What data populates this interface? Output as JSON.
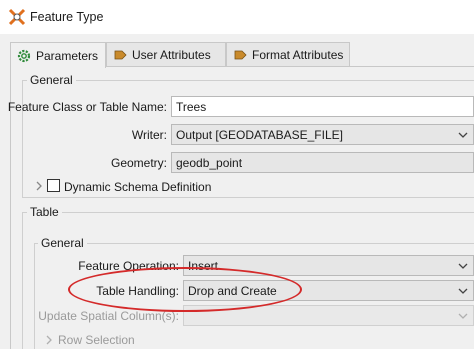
{
  "window": {
    "title": "Feature Type",
    "accent_color": "#d42a2a"
  },
  "tabs": [
    {
      "label": "Parameters",
      "icon": "gear-icon",
      "active": true
    },
    {
      "label": "User Attributes",
      "icon": "attribute-arrow-icon",
      "active": false
    },
    {
      "label": "Format Attributes",
      "icon": "attribute-arrow-icon",
      "active": false
    }
  ],
  "general": {
    "title": "General",
    "feature_class_label": "Feature Class or Table Name:",
    "feature_class_value": "Trees",
    "writer_label": "Writer:",
    "writer_value": "Output [GEODATABASE_FILE]",
    "geometry_label": "Geometry:",
    "geometry_value": "geodb_point",
    "dynamic_schema_label": "Dynamic Schema Definition",
    "dynamic_schema_checked": false
  },
  "table": {
    "title": "Table",
    "general_title": "General",
    "feature_operation_label": "Feature Operation:",
    "feature_operation_value": "Insert",
    "table_handling_label": "Table Handling:",
    "table_handling_value": "Drop and Create",
    "update_spatial_label": "Update Spatial Column(s):",
    "update_spatial_value": "",
    "row_selection_label": "Row Selection"
  }
}
